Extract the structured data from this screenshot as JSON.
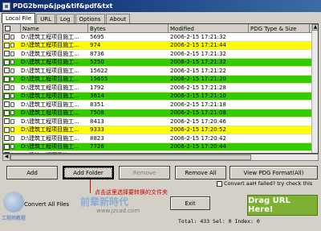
{
  "window": {
    "title": "PDG2bmp&jpg&tif&pdf&txt"
  },
  "tabs": [
    {
      "label": "Local File",
      "active": true
    },
    {
      "label": "URL",
      "active": false
    },
    {
      "label": "Log",
      "active": false
    },
    {
      "label": "Options",
      "active": false
    },
    {
      "label": "About",
      "active": false
    }
  ],
  "table": {
    "headers": [
      "Name",
      "Bytes",
      "Modified",
      "PDG Type & Size"
    ],
    "rows": [
      {
        "name": "D:\\建筑工程项目施工...",
        "bytes": "5695",
        "modified": "2006-2-15 17:21:32",
        "color": "#ffffff"
      },
      {
        "name": "D:\\建筑工程项目施工...",
        "bytes": "974",
        "modified": "2006-2-15 17:21:44",
        "color": "#ffff00"
      },
      {
        "name": "D:\\建筑工程项目施工...",
        "bytes": "8736",
        "modified": "2006-2-15 17:21:32",
        "color": "#ffffff"
      },
      {
        "name": "D:\\建筑工程项目施工...",
        "bytes": "5250",
        "modified": "2006-2-15 17:21:32",
        "color": "#33cc00"
      },
      {
        "name": "D:\\建筑工程项目施工...",
        "bytes": "15622",
        "modified": "2006-2-15 17:21:22",
        "color": "#ffffff"
      },
      {
        "name": "D:\\建筑工程项目施工...",
        "bytes": "15655",
        "modified": "2006-2-15 17:21:20",
        "color": "#33cc00"
      },
      {
        "name": "D:\\建筑工程项目施工...",
        "bytes": "1792",
        "modified": "2006-2-15 17:21:28",
        "color": "#ffffff"
      },
      {
        "name": "D:\\建筑工程项目施工...",
        "bytes": "3614",
        "modified": "2006-2-15 17:21:10",
        "color": "#33cc00"
      },
      {
        "name": "D:\\建筑工程项目施工...",
        "bytes": "8351",
        "modified": "2006-2-15 17:21:18",
        "color": "#ffffff"
      },
      {
        "name": "D:\\建筑工程项目施工...",
        "bytes": "7508",
        "modified": "2006-2-15 17:21:08",
        "color": "#33cc00"
      },
      {
        "name": "D:\\建筑工程项目施工...",
        "bytes": "8413",
        "modified": "2006-2-15 17:20:46",
        "color": "#ffffff"
      },
      {
        "name": "D:\\建筑工程项目施工...",
        "bytes": "9333",
        "modified": "2006-2-15 17:20:52",
        "color": "#ffff00"
      },
      {
        "name": "D:\\建筑工程项目施工...",
        "bytes": "8823",
        "modified": "2006-2-15 17:20:42",
        "color": "#ffffff"
      },
      {
        "name": "D:\\建筑工程项目施工...",
        "bytes": "7726",
        "modified": "2006-2-15 17:20:44",
        "color": "#33cc00"
      },
      {
        "name": "D:\\建筑工程项目施工...",
        "bytes": "8641",
        "modified": "2006-2-15 17:20:44",
        "color": "#ffffff"
      }
    ]
  },
  "buttons": {
    "add": "Add",
    "add_folder": "Add Folder",
    "remove": "Remove",
    "remove_all": "Remove All",
    "view_pdg": "View PDG Format(All)",
    "exit": "Exit"
  },
  "annotation": "点击这里选择要转换的文件夹",
  "convert_option": "Convert aaH failed? try check this",
  "convert_all": "Convert All Files",
  "drag_box": "Drag URL Here!",
  "status": "Total: 433 Sel: 0 Index: 0",
  "watermark": {
    "logo_text": "工程师教程",
    "chinese": "前辈新時代",
    "url": "www.jzcad.com"
  }
}
